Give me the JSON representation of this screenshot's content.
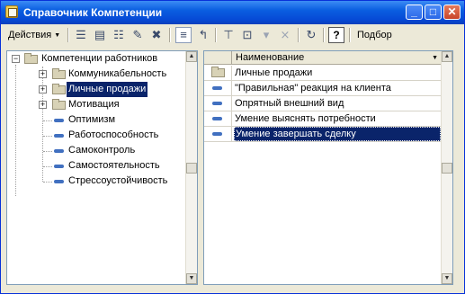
{
  "window": {
    "title": "Справочник Компетенции",
    "minimize_glyph": "_",
    "maximize_glyph": "□",
    "close_glyph": "✕"
  },
  "toolbar": {
    "actions_label": "Действия",
    "help_glyph": "?",
    "selection_label": "Подбор"
  },
  "tree": {
    "root": "Компетенции работников",
    "items": [
      {
        "label": "Коммуникабельность",
        "type": "folder",
        "expander": "+"
      },
      {
        "label": "Личные продажи",
        "type": "folder",
        "expander": "+",
        "selected": true
      },
      {
        "label": "Мотивация",
        "type": "folder",
        "expander": "+"
      },
      {
        "label": "Оптимизм",
        "type": "item"
      },
      {
        "label": "Работоспособность",
        "type": "item"
      },
      {
        "label": "Самоконтроль",
        "type": "item"
      },
      {
        "label": "Самостоятельность",
        "type": "item"
      },
      {
        "label": "Стрессоустойчивость",
        "type": "item"
      }
    ],
    "root_expander": "−"
  },
  "list": {
    "column_header": "Наименование",
    "rows": [
      {
        "label": "Личные продажи",
        "type": "folder"
      },
      {
        "label": "\"Правильная\" реакция на клиента",
        "type": "item"
      },
      {
        "label": "Опрятный внешний вид",
        "type": "item"
      },
      {
        "label": "Умение выяснять потребности",
        "type": "item"
      },
      {
        "label": "Умение завершать сделку",
        "type": "item",
        "selected": true
      }
    ]
  },
  "colors": {
    "selection": "#0a246a",
    "title_bar": "#0649d6",
    "item_icon": "#4170c0"
  }
}
